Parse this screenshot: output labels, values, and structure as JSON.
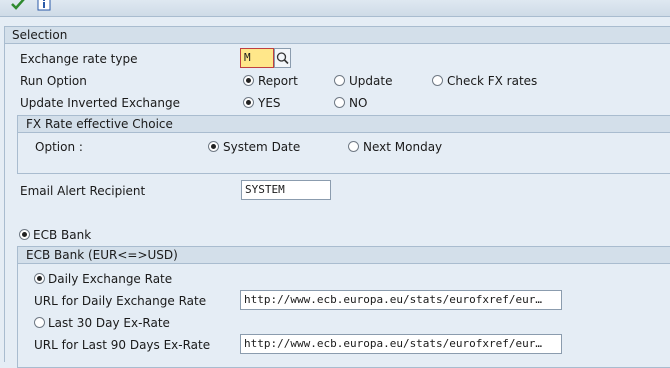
{
  "toolbar": {
    "execute_icon": "checkmark-icon",
    "info_icon": "info-icon"
  },
  "selection": {
    "title": "Selection",
    "exchange_rate_type": {
      "label": "Exchange rate type",
      "value": "M"
    },
    "run_option": {
      "label": "Run Option",
      "options": [
        "Report",
        "Update",
        "Check FX rates"
      ],
      "selected": "Report"
    },
    "update_inverted": {
      "label": "Update Inverted Exchange",
      "options": [
        "YES",
        "NO"
      ],
      "selected": "YES"
    },
    "fx_choice": {
      "title": "FX Rate effective Choice",
      "option_label": "Option :",
      "options": [
        "System Date",
        "Next Monday"
      ],
      "selected": "System Date"
    },
    "email": {
      "label": "Email Alert Recipient",
      "value": "SYSTEM"
    },
    "ecb_bank_radio": "ECB Bank",
    "ecb_group": {
      "title": "ECB Bank (EUR<=>USD)",
      "daily_radio": "Daily Exchange Rate",
      "daily_url_label": "URL for Daily Exchange Rate",
      "daily_url_value": "http://www.ecb.europa.eu/stats/eurofxref/eur…",
      "last30_radio": "Last 30 Day Ex-Rate",
      "last90_url_label": "URL for Last 90 Days Ex-Rate",
      "last90_url_value": "http://www.ecb.europa.eu/stats/eurofxref/eur…"
    }
  }
}
